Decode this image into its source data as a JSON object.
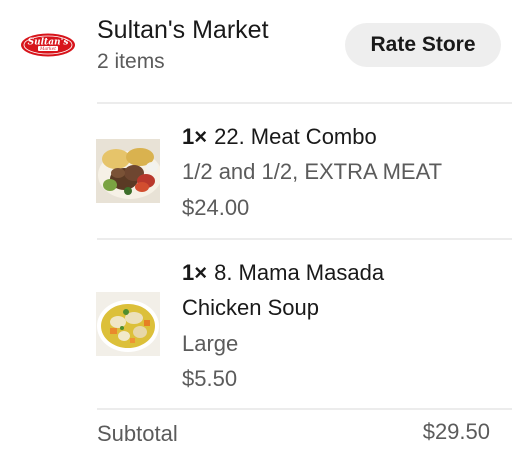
{
  "store": {
    "name": "Sultan's Market",
    "item_count": "2 items",
    "logo_text": "Sultan's Market",
    "rate_label": "Rate Store"
  },
  "items": [
    {
      "qty": "1×",
      "name": "22. Meat Combo",
      "options": "1/2 and 1/2, EXTRA MEAT",
      "price": "$24.00",
      "thumbnail_icon": "meat-combo-photo"
    },
    {
      "qty": "1×",
      "name_line1": "8.  Mama Masada",
      "name_line2": "Chicken Soup",
      "options": "Large",
      "price": "$5.50",
      "thumbnail_icon": "chicken-soup-photo"
    }
  ],
  "subtotal": {
    "label": "Subtotal",
    "value": "$29.50"
  },
  "colors": {
    "primary_text": "#191919",
    "secondary_text": "#5b5b5b",
    "button_bg": "#eeeeee",
    "divider": "#ececec",
    "logo_red": "#d7141b"
  }
}
